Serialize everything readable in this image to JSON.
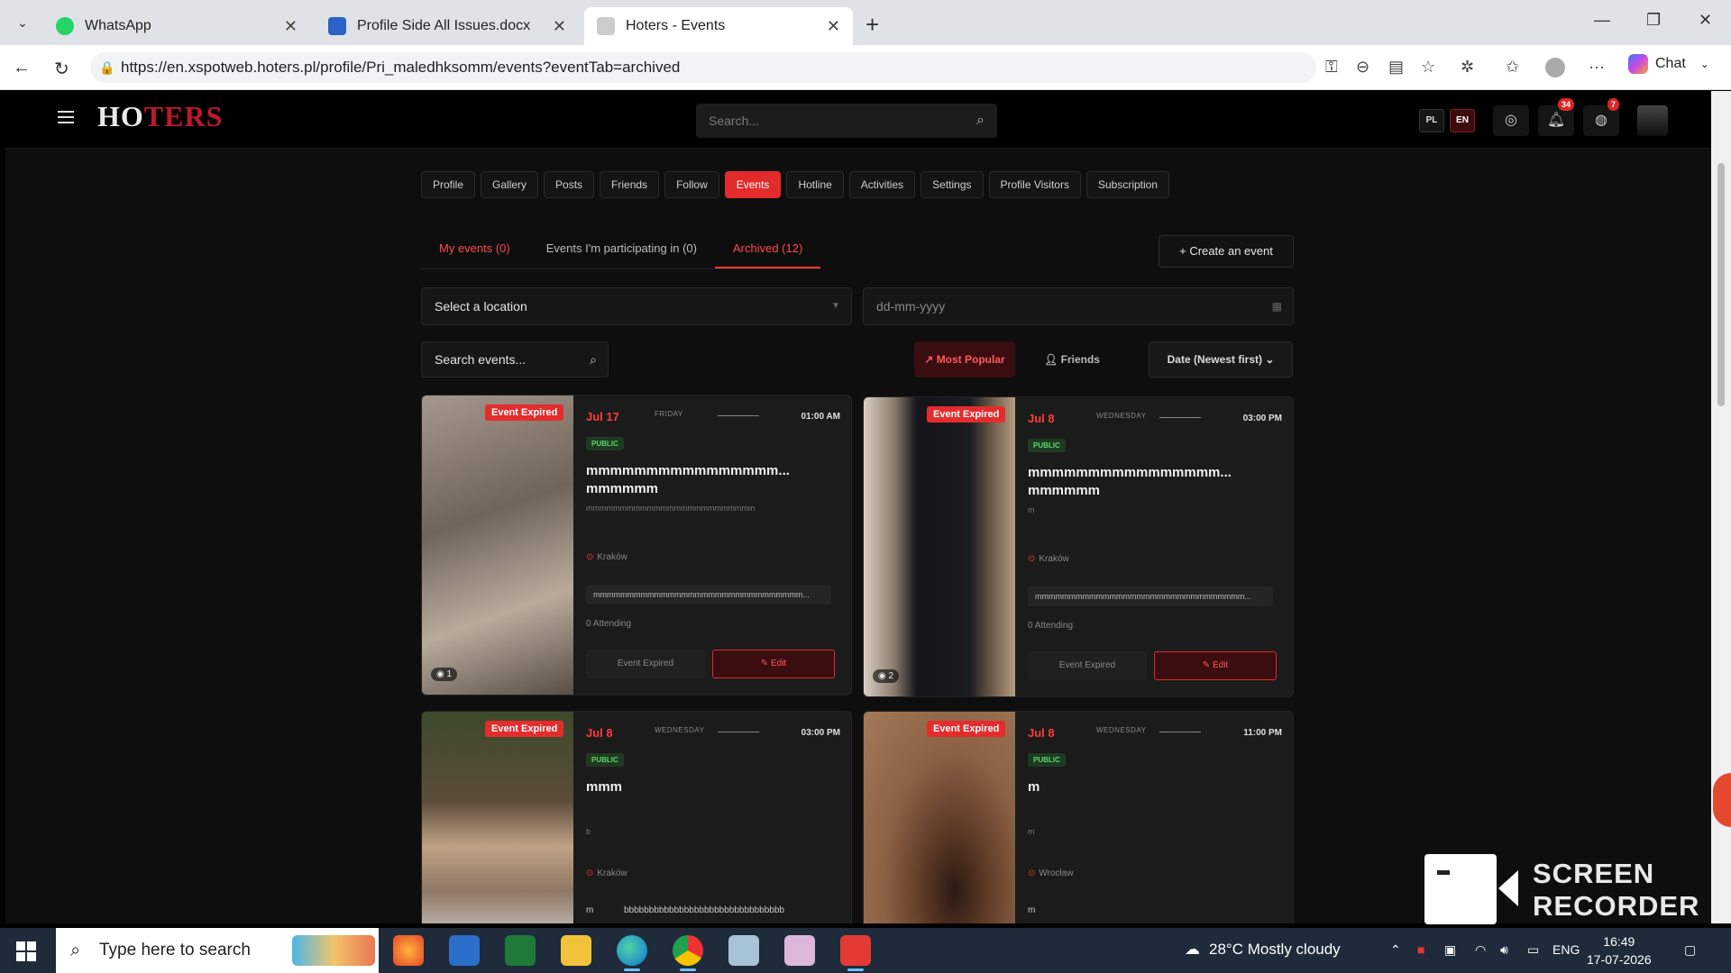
{
  "browser": {
    "tabs": [
      {
        "title": "WhatsApp",
        "icon": "whatsapp-icon"
      },
      {
        "title": "Profile Side All Issues.docx",
        "icon": "word-icon"
      },
      {
        "title": "Hoters - Events",
        "icon": "page-icon"
      }
    ],
    "url": "https://en.xspotweb.hoters.pl/profile/Pri_maledhksomm/events?eventTab=archived",
    "chat_label": "Chat"
  },
  "app": {
    "logo_pre": "HO",
    "logo_t": "T",
    "logo_post": "ERS",
    "search_placeholder": "Search...",
    "lang_pl": "PL",
    "lang_en": "EN",
    "notif_count": "34",
    "msg_count": "7",
    "accent": "#e32b2b"
  },
  "nav_tabs": [
    "Profile",
    "Gallery",
    "Posts",
    "Friends",
    "Follow",
    "Events",
    "Hotline",
    "Activities",
    "Settings",
    "Profile Visitors",
    "Subscription"
  ],
  "sub_tabs": {
    "my_events": "My events (0)",
    "participating": "Events I'm participating in (0)",
    "archived": "Archived (12)",
    "create": "Create an event"
  },
  "filters": {
    "location_placeholder": "Select a location",
    "date_placeholder": "dd-mm-yyyy",
    "search_placeholder": "Search events...",
    "most_popular": "Most Popular",
    "friends": "Friends",
    "sort": "Date (Newest first)"
  },
  "cards": [
    {
      "expired": "Event Expired",
      "date": "Jul 17",
      "day": "FRIDAY",
      "time": "01:00 AM",
      "visibility": "PUBLIC",
      "title": "mmmmmmmmmmmmmmmm... mmmmmm",
      "desc": "mmmmmmmmmmmmmmmmmmmmmmmmm",
      "location": "Kraków",
      "tag": "mmmmmmmmmmmmmmmmmmmmmmmmmmmmmmm...",
      "attending": "0 Attending",
      "status_btn": "Event Expired",
      "edit_btn": "Edit",
      "views": "1"
    },
    {
      "expired": "Event Expired",
      "date": "Jul 8",
      "day": "WEDNESDAY",
      "time": "03:00 PM",
      "visibility": "PUBLIC",
      "title": "mmmmmmmmmmmmmmmm... mmmmmm",
      "desc": "m",
      "location": "Kraków",
      "tag": "mmmmmmmmmmmmmmmmmmmmmmmmmmmmmmm...",
      "attending": "0 Attending",
      "status_btn": "Event Expired",
      "edit_btn": "Edit",
      "views": "2"
    },
    {
      "expired": "Event Expired",
      "date": "Jul 8",
      "day": "WEDNESDAY",
      "time": "03:00 PM",
      "visibility": "PUBLIC",
      "title": "mmm",
      "desc": "b",
      "location": "Kraków",
      "tag_a": "m",
      "tag_b": "bbbbbbbbbbbbbbbbbbbbbbbbbbbbbbbb"
    },
    {
      "expired": "Event Expired",
      "date": "Jul 8",
      "day": "WEDNESDAY",
      "time": "11:00 PM",
      "visibility": "PUBLIC",
      "title": "m",
      "desc": "m",
      "location": "Wrocław",
      "tag_a": "m"
    }
  ],
  "recorder": {
    "line1": "SCREEN",
    "line2": "RECORDER"
  },
  "taskbar": {
    "search_placeholder": "Type here to search",
    "weather": "28°C  Mostly cloudy",
    "lang": "ENG",
    "time": "16:49",
    "date": "17-07-2026"
  }
}
